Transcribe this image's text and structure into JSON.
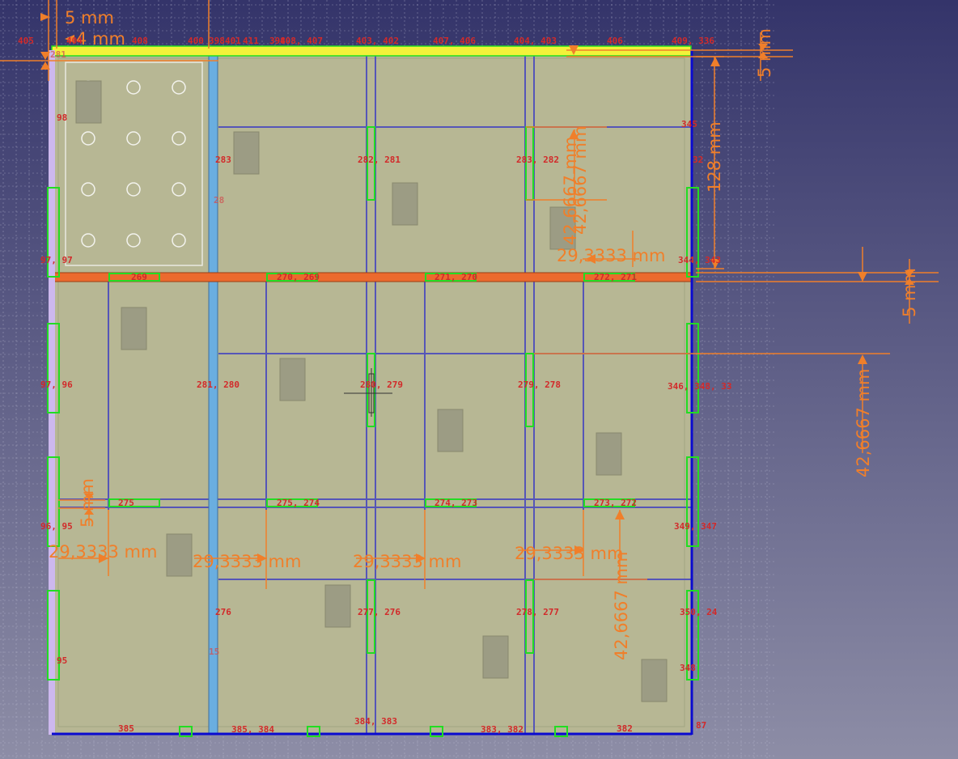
{
  "colors": {
    "bg_top": "#34346a",
    "bg_bottom": "#8d8da6",
    "grid": "#c9c9dd",
    "panel": "#b7b794",
    "panel_edge": "#8e9268",
    "constraint": "#5555b8",
    "rail_blue": "#6aaee0",
    "bar_orange": "#ec6a2e",
    "bar_yellow": "#f2f23a",
    "dimension": "#f07f2a",
    "constraint_text": "#d22a2a",
    "selected_green": "#22dd22",
    "edge_dark_blue": "#0a0ad0",
    "edge_violet": "#cdb8ee"
  },
  "dimensions": {
    "d_5mm_top": "5 mm",
    "d_4mm_top": "4 mm",
    "d_5mm_top_right": "5 mm",
    "d_128mm": "128 mm",
    "d_42_a": "42,6667 mm",
    "d_42_b": "42,6667 mm",
    "d_29_upper": "29,3333 mm",
    "d_5mm_middle_right": "5 mm",
    "d_42_right": "42,6667 mm",
    "d_5mm_left": "5 mm",
    "d_29_1": "29,3333 mm",
    "d_29_2": "29,3333 mm",
    "d_29_3": "29,3333 mm",
    "d_29_4": "29,3333 mm",
    "d_42_bottom": "42,6667 mm"
  },
  "constraint_labels": [
    "405",
    "404",
    "408",
    "400",
    "398",
    "401",
    "411",
    "398",
    "408, 407",
    "403, 402",
    "407, 406",
    "404, 403",
    "406",
    "409, 336",
    "98",
    "283",
    "282, 281",
    "283, 282",
    "345",
    "32",
    "97, 97",
    "269",
    "270, 269",
    "271, 270",
    "272, 271",
    "344, 343",
    "97, 96",
    "281, 280",
    "280, 279",
    "279, 278",
    "346, 348, 33",
    "275",
    "275, 274",
    "274, 273",
    "273, 272",
    "96, 95",
    "349, 347",
    "276",
    "277, 276",
    "278, 277",
    "350, 24",
    "95",
    "348",
    "385",
    "385, 384",
    "384, 383",
    "383, 382",
    "382",
    "87"
  ],
  "constraint_labels_faint": [
    "281",
    "28",
    "15"
  ]
}
